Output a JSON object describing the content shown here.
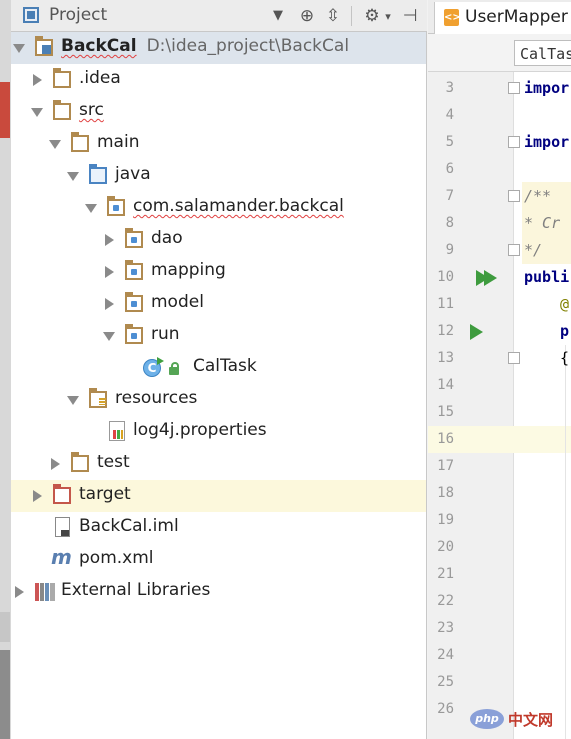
{
  "project_panel": {
    "title": "Project",
    "dropdown_glyph": "▼",
    "toolbar": [
      {
        "name": "scroll-from-source-icon",
        "glyph": "⊕"
      },
      {
        "name": "collapse-all-icon",
        "glyph": "⇳"
      },
      {
        "name": "settings-gear-icon",
        "glyph": "⚙"
      },
      {
        "name": "hide-panel-icon",
        "glyph": "⊣"
      }
    ],
    "tree": {
      "module_name": "BackCal",
      "module_path": "D:\\idea_project\\BackCal",
      "idea": ".idea",
      "src": "src",
      "main": "main",
      "java": "java",
      "package": "com.salamander.backcal",
      "dao": "dao",
      "mapping": "mapping",
      "model": "model",
      "run": "run",
      "caltask": "CalTask",
      "resources": "resources",
      "log4j": "log4j.properties",
      "test": "test",
      "target": "target",
      "iml": "BackCal.iml",
      "pom": "pom.xml",
      "external_libraries": "External Libraries"
    }
  },
  "editor": {
    "tab_label": "UserMapper",
    "tab_icon_glyph": "<>",
    "breadcrumb": "CalTas",
    "line_numbers": [
      "3",
      "4",
      "5",
      "6",
      "7",
      "8",
      "9",
      "10",
      "11",
      "12",
      "13",
      "14",
      "15",
      "16",
      "17",
      "18",
      "19",
      "20",
      "21",
      "22",
      "23",
      "24",
      "25",
      "26"
    ],
    "code": {
      "line3": "impor",
      "line5": "impor",
      "line7": "/**",
      "line8": " * Cr",
      "line9": " */",
      "line10": "publi",
      "line11": "@",
      "line12": "p",
      "line13": "{"
    }
  },
  "watermark": {
    "badge": "php",
    "text": "中文网"
  },
  "colors": {
    "selection": "#dde4ec",
    "ignored_row": "#fcf8dc",
    "caret_row": "#fcfae3",
    "keyword": "#000080"
  }
}
